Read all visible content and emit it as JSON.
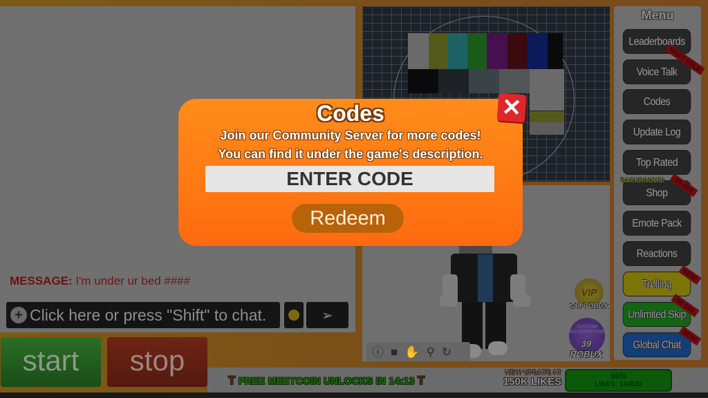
{
  "modal": {
    "title": "Codes",
    "description_line1": "Join our Community Server for more codes!",
    "description_line2": "You can find it under the game's description.",
    "code_input_placeholder": "ENTER CODE",
    "code_input_value": "",
    "redeem_label": "Redeem",
    "close_icon": "✕"
  },
  "menu": {
    "title": "Menu",
    "items": [
      {
        "label": "Leaderboards",
        "style": "dark"
      },
      {
        "label": "Voice Talk",
        "style": "dark"
      },
      {
        "label": "Codes",
        "style": "dark"
      },
      {
        "label": "Update Log",
        "style": "dark"
      },
      {
        "label": "Top Rated",
        "style": "dark"
      },
      {
        "label": "Shop",
        "style": "dark",
        "tag": "BACKROOMS!"
      },
      {
        "label": "Emote Pack",
        "style": "dark"
      },
      {
        "label": "Reactions",
        "style": "dark"
      },
      {
        "label": "Trolling",
        "style": "yellow"
      },
      {
        "label": "Unlimited Skip",
        "style": "green"
      },
      {
        "label": "Global Chat",
        "style": "blue"
      }
    ],
    "ribbons": [
      "MOST SOLD",
      "-25 OFF",
      "NEW!",
      "-50 OFF",
      "NEW!"
    ]
  },
  "chat": {
    "message_label": "MESSAGE:",
    "message_text": " I'm under ur bed ####",
    "input_placeholder": "Click here or press \"Shift\" to chat.",
    "plus_icon": "+",
    "send_icon": "➢"
  },
  "controls": {
    "start_label": "start",
    "stop_label": "stop"
  },
  "avatar_toolbar": {
    "icons": [
      "info-icon",
      "camera-icon",
      "hand-icon",
      "zoom-icon",
      "rotate-icon"
    ],
    "glyphs": [
      "ⓘ",
      "■",
      "✋",
      "⚲",
      "↻"
    ]
  },
  "purchases": {
    "vip_label": "VIP",
    "vip_price": "149 ROBUX",
    "custom_label": "CUSTOM BACKGROUND",
    "custom_price": "39 ROBUX"
  },
  "bottom_bar": {
    "meetcoin_text": "FREE MEETCOIN UNLOCKS IN 14:13",
    "t_icon": "T",
    "update_line1": "NEW UPDATE AT",
    "update_line2": "150K LIKES",
    "likes_percent": "96%",
    "likes_percent_value": 96,
    "likes_count": "LIKES: 144583"
  },
  "colors": {
    "modal_orange": "#ff7a14",
    "close_red": "#e0262a",
    "redeem_brown": "#b8620a"
  }
}
